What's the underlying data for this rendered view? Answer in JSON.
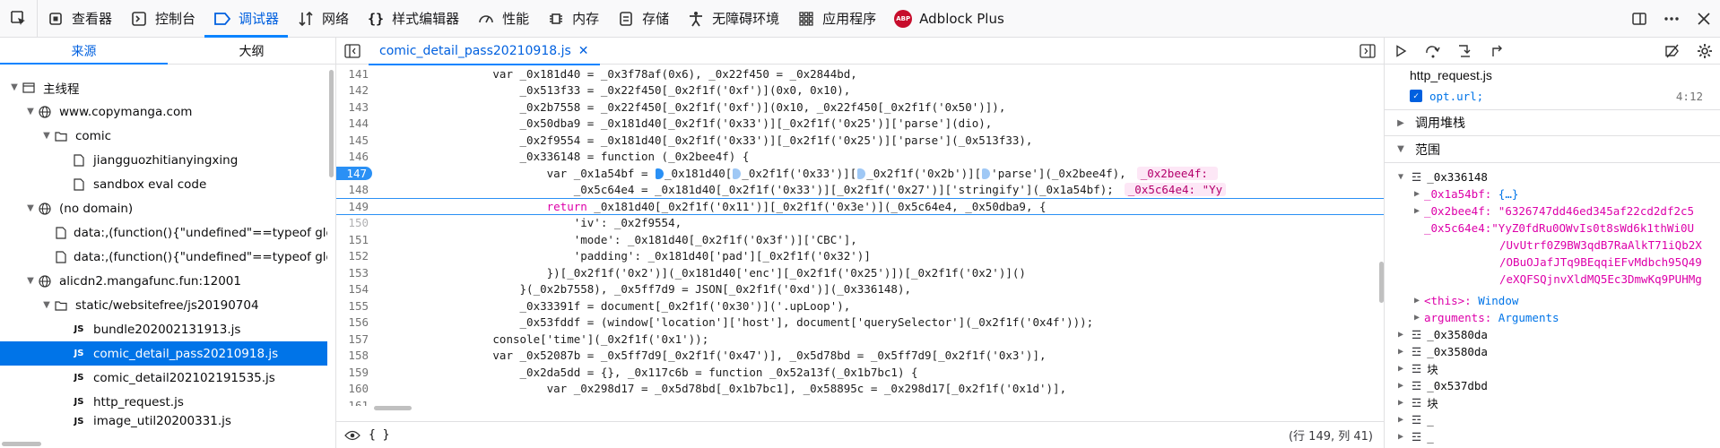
{
  "toolbar": {
    "tabs": [
      {
        "label": "查看器"
      },
      {
        "label": "控制台"
      },
      {
        "label": "调试器"
      },
      {
        "label": "网络"
      },
      {
        "label": "样式编辑器"
      },
      {
        "label": "性能"
      },
      {
        "label": "内存"
      },
      {
        "label": "存储"
      },
      {
        "label": "无障碍环境"
      },
      {
        "label": "应用程序"
      },
      {
        "label": "Adblock Plus"
      }
    ],
    "abp_badge": "ABP",
    "accent_color": "#0a84ff"
  },
  "sources": {
    "tab_sources": "来源",
    "tab_outline": "大纲",
    "tree": [
      {
        "label": "主线程"
      },
      {
        "label": "www.copymanga.com"
      },
      {
        "label": "comic"
      },
      {
        "label": "jiangguozhitianyingxing"
      },
      {
        "label": "sandbox eval code"
      },
      {
        "label": "(no domain)"
      },
      {
        "label": "data:,(function(){\"undefined\"==typeof glob"
      },
      {
        "label": "data:,(function(){\"undefined\"==typeof glob"
      },
      {
        "label": "alicdn2.mangafunc.fun:12001"
      },
      {
        "label": "static/websitefree/js20190704"
      },
      {
        "label": "bundle202002131913.js"
      },
      {
        "label": "comic_detail_pass20210918.js"
      },
      {
        "label": "comic_detail202102191535.js"
      },
      {
        "label": "http_request.js"
      },
      {
        "label": "image_util20200331.js"
      }
    ],
    "js_badge": "JS"
  },
  "editor": {
    "file_tab": "comic_detail_pass20210918.js",
    "close_glyph": "✕",
    "lines": [
      {
        "n": "141",
        "t": "                var _0x181d40 = _0x3f78af(0x6), _0x22f450 = _0x2844bd,"
      },
      {
        "n": "142",
        "t": "                    _0x513f33 = _0x22f450[_0x2f1f('0xf')](0x0, 0x10),"
      },
      {
        "n": "143",
        "t": "                    _0x2b7558 = _0x22f450[_0x2f1f('0xf')](0x10, _0x22f450[_0x2f1f('0x50')]),"
      },
      {
        "n": "144",
        "t": "                    _0x50dba9 = _0x181d40[_0x2f1f('0x33')][_0x2f1f('0x25')]['parse'](dio),"
      },
      {
        "n": "145",
        "t": "                    _0x2f9554 = _0x181d40[_0x2f1f('0x33')][_0x2f1f('0x25')]['parse'](_0x513f33),"
      },
      {
        "n": "146",
        "t": "                    _0x336148 = function (_0x2bee4f) {"
      },
      {
        "n": "147",
        "t": "                        var _0x1a54bf = ",
        "t2": "_0x181d40[",
        "t3": "_0x2f1f('0x33')][",
        "t4": "_0x2f1f('0x2b')][",
        "t5": "'parse'](_0x2bee4f),",
        "preview": "_0x2bee4f: "
      },
      {
        "n": "148",
        "t": "                            _0x5c64e4 = _0x181d40[_0x2f1f('0x33')][_0x2f1f('0x27')]['stringify'](_0x1a54bf);",
        "preview": "_0x5c64e4: \"Yy"
      },
      {
        "n": "149",
        "t_kw": "return",
        "t_pre": "                        ",
        "t": " _0x181d40[_0x2f1f('0x11')][_0x2f1f('0x3e')](_0x5c64e4, _0x50dba9, {"
      },
      {
        "n": "150",
        "t": "                            'iv': _0x2f9554,"
      },
      {
        "n": "151",
        "t": "                            'mode': _0x181d40[_0x2f1f('0x3f')]['CBC'],"
      },
      {
        "n": "152",
        "t": "                            'padding': _0x181d40['pad'][_0x2f1f('0x32')]"
      },
      {
        "n": "153",
        "t": "                        })[_0x2f1f('0x2')](_0x181d40['enc'][_0x2f1f('0x25')])[_0x2f1f('0x2')]()"
      },
      {
        "n": "154",
        "t": "                    }(_0x2b7558), _0x5ff7d9 = JSON[_0x2f1f('0xd')](_0x336148),"
      },
      {
        "n": "155",
        "t": "                    _0x33391f = document[_0x2f1f('0x30')]('.upLoop'),"
      },
      {
        "n": "156",
        "t": "                    _0x53fddf = (window['location']['host'], document['querySelector'](_0x2f1f('0x4f')));"
      },
      {
        "n": "157",
        "t": "                console['time'](_0x2f1f('0x1'));"
      },
      {
        "n": "158",
        "t": "                var _0x52087b = _0x5ff7d9[_0x2f1f('0x47')], _0x5d78bd = _0x5ff7d9[_0x2f1f('0x3')],"
      },
      {
        "n": "159",
        "t": "                    _0x2da5dd = {}, _0x117c6b = function _0x52a13f(_0x1b7bc1) {"
      },
      {
        "n": "160",
        "t": "                        var _0x298d17 = _0x5d78bd[_0x1b7bc1], _0x58895c = _0x298d17[_0x2f1f('0x1d')],"
      },
      {
        "n": "161",
        "t": ""
      }
    ],
    "footer_braces": "{ }",
    "cursor_position": "(行 149, 列 41)"
  },
  "debugger": {
    "frame_file": "http_request.js",
    "frame_expr": "opt.url;",
    "frame_line": "4:12",
    "section_callstack": "调用堆栈",
    "section_scopes": "范围",
    "scope_name": "_0x336148",
    "vars": [
      {
        "name": "_0x1a54bf:",
        "value": "{…}"
      },
      {
        "name": "_0x2bee4f:",
        "value": "\"6326747dd46ed345af22cd2df2c5"
      },
      {
        "name": "_0x5c64e4:",
        "value": "\"YyZ0fdRu0OWvIs0t8sWd6k1thWi0U"
      }
    ],
    "wrap_lines": [
      "/UvUtrf0Z9BW3qdB7RaAlkT71iQb2X",
      "/OBuOJafJTq9BEqqiEFvMdbch95Q49",
      "/eXQFSQjnvXldMQ5Ec3DmwKq9PUHMg"
    ],
    "this_label": "<this>:",
    "this_value": "Window",
    "args_label": "arguments:",
    "args_value": "Arguments",
    "scope_rows": [
      "_0x3580da",
      "_0x3580da",
      "块",
      "_0x537dbd",
      "块",
      "_",
      "_"
    ]
  }
}
